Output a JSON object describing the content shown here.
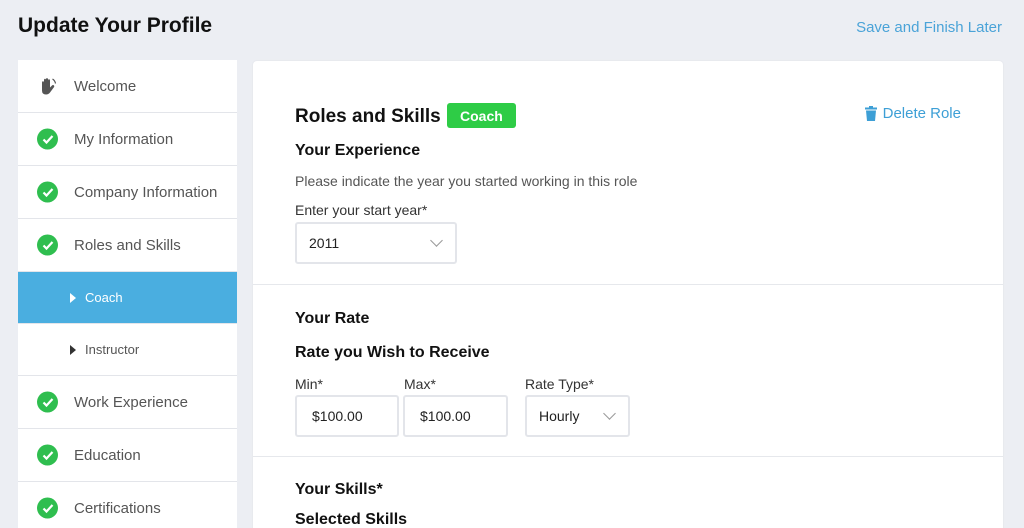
{
  "header": {
    "title": "Update Your Profile",
    "save_later": "Save and Finish Later"
  },
  "sidebar": {
    "items": [
      {
        "label": "Welcome",
        "icon": "wave-hand-icon"
      },
      {
        "label": "My Information",
        "icon": "check-icon"
      },
      {
        "label": "Company Information",
        "icon": "check-icon"
      },
      {
        "label": "Roles and Skills",
        "icon": "check-icon"
      },
      {
        "label": "Coach",
        "icon": "triangle-right-icon",
        "active": true
      },
      {
        "label": "Instructor",
        "icon": "triangle-right-icon"
      },
      {
        "label": "Work Experience",
        "icon": "check-icon"
      },
      {
        "label": "Education",
        "icon": "check-icon"
      },
      {
        "label": "Certifications",
        "icon": "check-icon"
      }
    ]
  },
  "main": {
    "roles_title": "Roles and Skills",
    "role_badge": "Coach",
    "delete_role": "Delete Role",
    "experience": {
      "heading": "Your Experience",
      "help": "Please indicate the year you started working in this role",
      "start_year_label": "Enter your start year*",
      "start_year_value": "2011"
    },
    "rate": {
      "heading": "Your Rate",
      "subheading": "Rate you Wish to Receive",
      "min_label": "Min*",
      "min_value": "$100.00",
      "max_label": "Max*",
      "max_value": "$100.00",
      "type_label": "Rate Type*",
      "type_value": "Hourly"
    },
    "skills": {
      "heading": "Your Skills*",
      "selected_heading": "Selected Skills"
    }
  },
  "colors": {
    "accent": "#4aaee0",
    "success": "#2fbe4f",
    "badge": "#2ecc46",
    "link": "#4aa3d8"
  }
}
